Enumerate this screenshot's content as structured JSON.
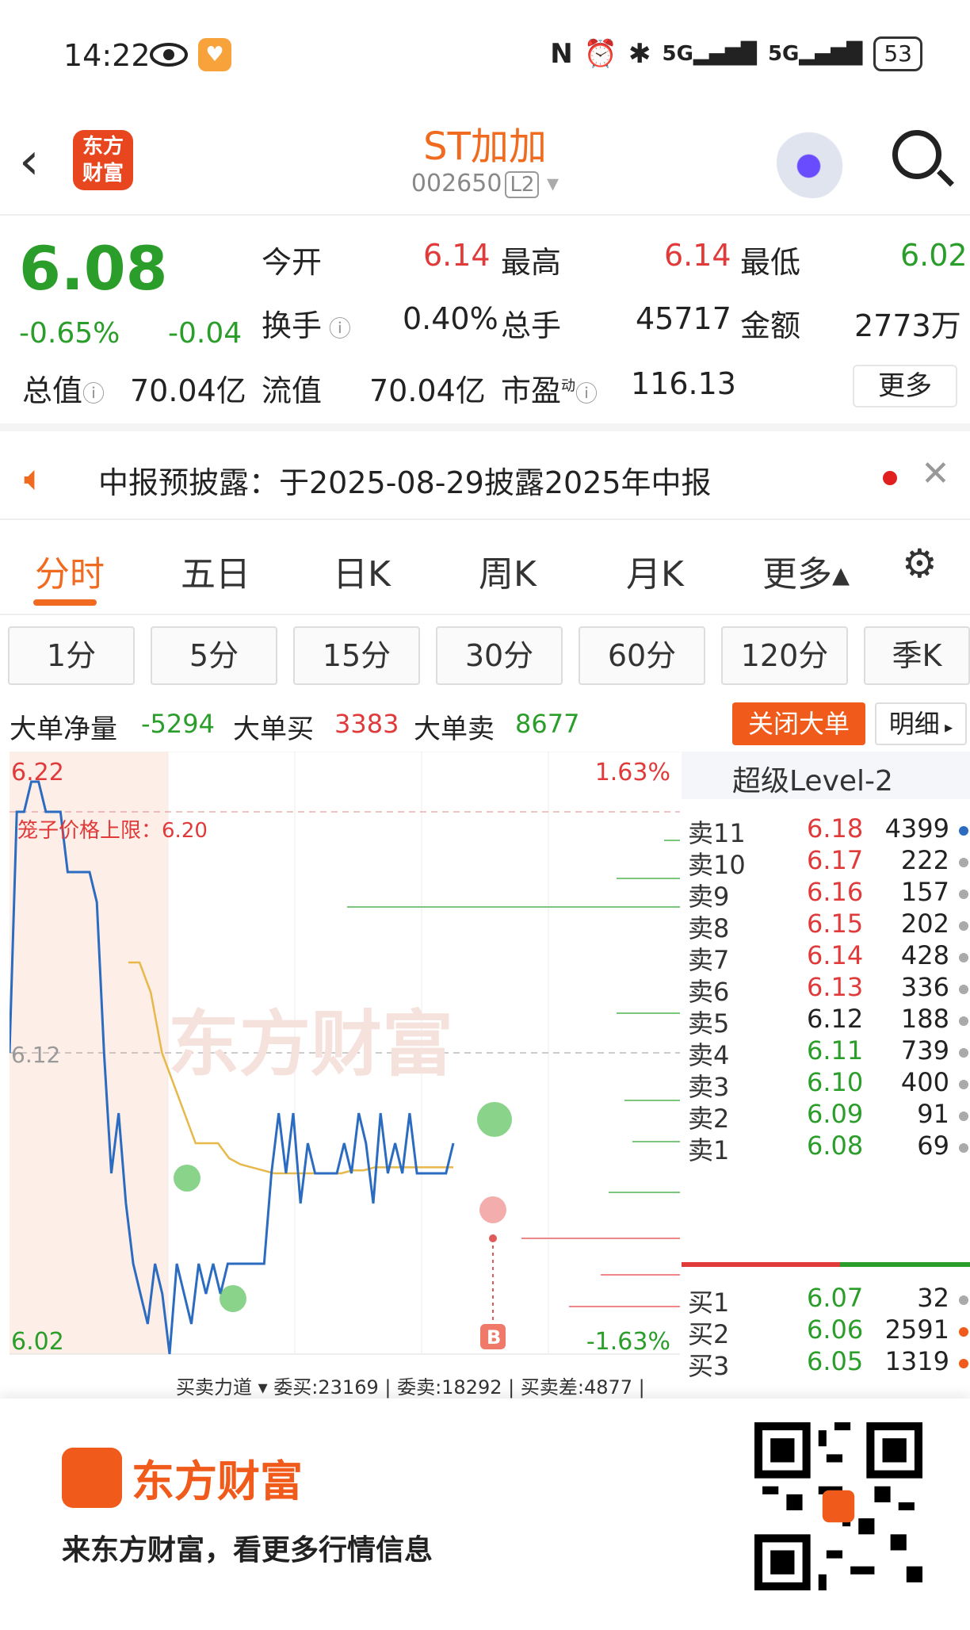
{
  "status": {
    "time": "14:22",
    "battery": "53",
    "net1": "5G",
    "net2": "5G"
  },
  "header": {
    "back_label": "<",
    "logo_line1": "东方",
    "logo_line2": "财富",
    "stock_name": "ST加加",
    "stock_code": "002650",
    "level_tag": "L2"
  },
  "quote": {
    "price": "6.08",
    "change_pct": "-0.65%",
    "change_amt": "-0.04",
    "open_label": "今开",
    "open": "6.14",
    "high_label": "最高",
    "high": "6.14",
    "low_label": "最低",
    "low": "6.02",
    "turnover_label": "换手",
    "turnover": "0.40%",
    "vol_label": "总手",
    "vol": "45717",
    "amount_label": "金额",
    "amount": "2773万",
    "mcap_label": "总值",
    "mcap": "70.04亿",
    "float_label": "流值",
    "float": "70.04亿",
    "pe_label": "市盈",
    "pe_sup": "动",
    "pe": "116.13",
    "more": "更多"
  },
  "notice": {
    "text": "中报预披露：于2025-08-29披露2025年中报"
  },
  "tabs": [
    {
      "label": "分时"
    },
    {
      "label": "五日"
    },
    {
      "label": "日K"
    },
    {
      "label": "周K"
    },
    {
      "label": "月K"
    },
    {
      "label": "更多▴"
    }
  ],
  "subtabs": [
    {
      "label": "1分"
    },
    {
      "label": "5分"
    },
    {
      "label": "15分"
    },
    {
      "label": "30分"
    },
    {
      "label": "60分"
    },
    {
      "label": "120分"
    },
    {
      "label": "季K"
    }
  ],
  "bigorder": {
    "net_label": "大单净量",
    "net": "-5294",
    "buy_label": "大单买",
    "buy": "3383",
    "sell_label": "大单卖",
    "sell": "8677",
    "close_btn": "关闭大单",
    "detail_btn": "明细"
  },
  "chart_data": {
    "type": "line",
    "title": "",
    "y_top": "6.22",
    "y_mid": "6.12",
    "y_bottom": "6.02",
    "pct_top": "1.63%",
    "pct_bottom": "-1.63%",
    "ylim": [
      6.02,
      6.22
    ],
    "cage_label": "笼子价格上限：",
    "cage_value": "6.20",
    "watermark": "东方财富",
    "marker": "B",
    "bottom_line": "买卖力道 ▾  委买:23169 | 委卖:18292 | 买卖差:4877 |",
    "price": [
      6.12,
      6.2,
      6.2,
      6.21,
      6.21,
      6.2,
      6.2,
      6.2,
      6.18,
      6.18,
      6.18,
      6.18,
      6.17,
      6.12,
      6.08,
      6.1,
      6.07,
      6.05,
      6.04,
      6.03,
      6.05,
      6.04,
      6.02,
      6.05,
      6.04,
      6.03,
      6.05,
      6.04,
      6.05,
      6.04,
      6.05,
      6.05,
      6.05,
      6.05,
      6.05,
      6.05,
      6.08,
      6.1,
      6.08,
      6.1,
      6.07,
      6.09,
      6.08,
      6.08,
      6.08,
      6.08,
      6.09,
      6.08,
      6.1,
      6.09,
      6.07,
      6.1,
      6.08,
      6.09,
      6.08,
      6.1,
      6.08,
      6.08,
      6.08,
      6.08,
      6.08,
      6.09
    ],
    "avg": [
      6.15,
      6.15,
      6.14,
      6.12,
      6.11,
      6.1,
      6.09,
      6.09,
      6.09,
      6.085,
      6.083,
      6.082,
      6.081,
      6.08,
      6.08,
      6.08,
      6.08,
      6.08,
      6.08,
      6.08,
      6.081,
      6.081,
      6.082,
      6.082,
      6.082,
      6.082,
      6.082,
      6.082,
      6.082,
      6.082
    ]
  },
  "level2": {
    "title": "超级Level-2",
    "sells": [
      {
        "label": "卖11",
        "price": "6.18",
        "vol": "4399"
      },
      {
        "label": "卖10",
        "price": "6.17",
        "vol": "222"
      },
      {
        "label": "卖9",
        "price": "6.16",
        "vol": "157"
      },
      {
        "label": "卖8",
        "price": "6.15",
        "vol": "202"
      },
      {
        "label": "卖7",
        "price": "6.14",
        "vol": "428"
      },
      {
        "label": "卖6",
        "price": "6.13",
        "vol": "336"
      },
      {
        "label": "卖5",
        "price": "6.12",
        "vol": "188"
      },
      {
        "label": "卖4",
        "price": "6.11",
        "vol": "739"
      },
      {
        "label": "卖3",
        "price": "6.10",
        "vol": "400"
      },
      {
        "label": "卖2",
        "price": "6.09",
        "vol": "91"
      },
      {
        "label": "卖1",
        "price": "6.08",
        "vol": "69"
      }
    ],
    "buys": [
      {
        "label": "买1",
        "price": "6.07",
        "vol": "32"
      },
      {
        "label": "买2",
        "price": "6.06",
        "vol": "2591"
      },
      {
        "label": "买3",
        "price": "6.05",
        "vol": "1319"
      }
    ]
  },
  "footer": {
    "brand": "东方财富",
    "slogan": "来东方财富，看更多行情信息"
  },
  "colors": {
    "up": "#e03a3a",
    "down": "#2a9d2a",
    "accent": "#f06a1f",
    "line": "#2c6cc0",
    "avg": "#e7b84a"
  }
}
